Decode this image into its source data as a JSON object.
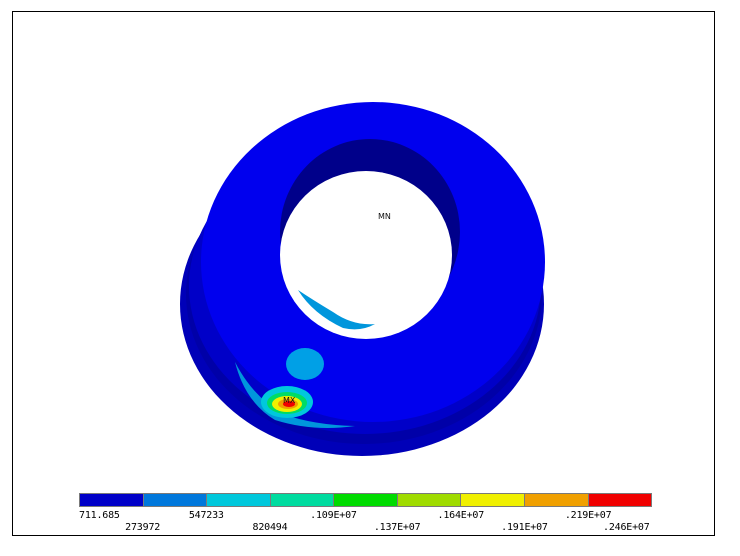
{
  "markers": {
    "min": "MN",
    "max": "MX"
  },
  "legend": {
    "colors": [
      "#0000c8",
      "#0078dc",
      "#00c8dc",
      "#00dca0",
      "#00dc00",
      "#a0dc00",
      "#f0f000",
      "#f0a000",
      "#f00000"
    ],
    "labels": [
      "711.685",
      "273972",
      "547233",
      "820494",
      ".109E+07",
      ".137E+07",
      ".164E+07",
      ".191E+07",
      ".219E+07",
      ".246E+07"
    ]
  },
  "colors": {
    "body": "#0000ee",
    "body_dark": "#0000b4",
    "inner_wall": "#00008c",
    "contour_low": "#0096dc",
    "contour_hot": "#ff0000",
    "contour_yellow": "#f0f000"
  }
}
